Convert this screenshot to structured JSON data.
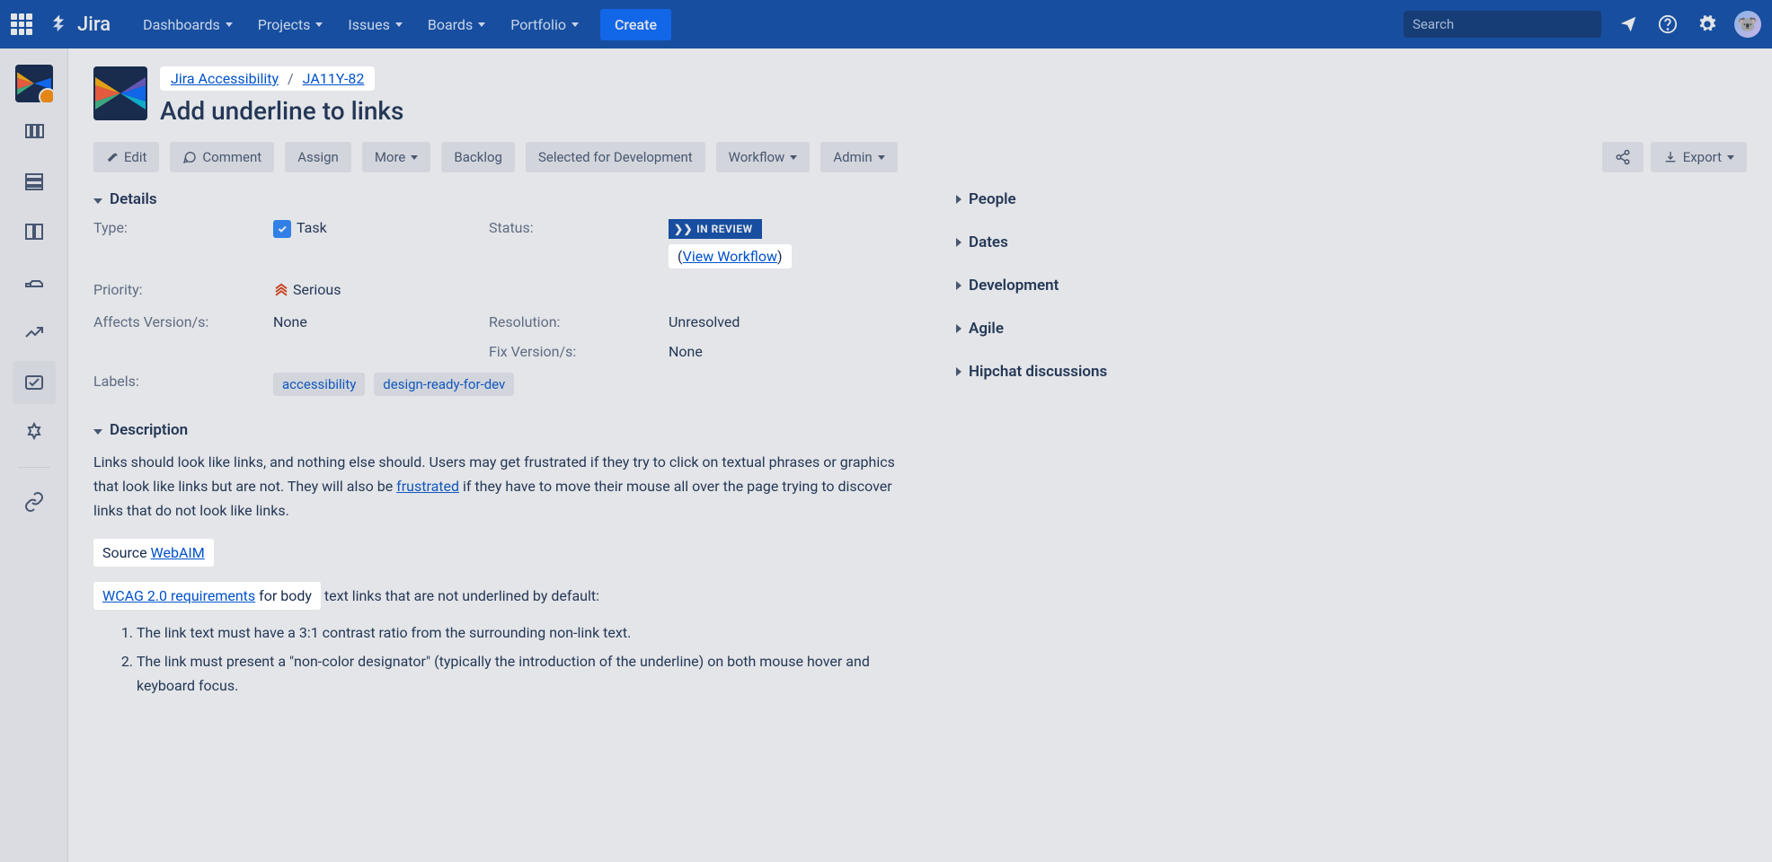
{
  "nav": {
    "logo": "Jira",
    "items": [
      "Dashboards",
      "Projects",
      "Issues",
      "Boards",
      "Portfolio"
    ],
    "create": "Create",
    "search_placeholder": "Search"
  },
  "breadcrumb": {
    "project": "Jira Accessibility",
    "issue_key": "JA11Y-82"
  },
  "issue": {
    "title": "Add underline to links"
  },
  "actions": {
    "edit": "Edit",
    "comment": "Comment",
    "assign": "Assign",
    "more": "More",
    "backlog": "Backlog",
    "selected": "Selected for Development",
    "workflow": "Workflow",
    "admin": "Admin",
    "export": "Export"
  },
  "details": {
    "header": "Details",
    "type_label": "Type:",
    "type_value": "Task",
    "priority_label": "Priority:",
    "priority_value": "Serious",
    "affects_label": "Affects Version/s:",
    "affects_value": "None",
    "labels_label": "Labels:",
    "labels": [
      "accessibility",
      "design-ready-for-dev"
    ],
    "status_label": "Status:",
    "status_value": "IN REVIEW",
    "view_workflow": "View Workflow",
    "resolution_label": "Resolution:",
    "resolution_value": "Unresolved",
    "fix_label": "Fix Version/s:",
    "fix_value": "None"
  },
  "description": {
    "header": "Description",
    "p1a": "Links should look like links, and nothing else should. Users may get frustrated if they try to click on textual phrases or graphics that look like links but are not. They will also be ",
    "p1_link": "frustrated",
    "p1b": " if they have to move their mouse all over the page trying to discover links that do not look like links.",
    "source_label": "Source ",
    "source_link": "WebAIM",
    "wcag_link": "WCAG 2.0 requirements",
    "wcag_rest": " for body text links that are not underlined by default:",
    "li1": "The link text must have a 3:1 contrast ratio from the surrounding non-link text.",
    "li2": "The link must present a \"non-color designator\" (typically the introduction of the underline) on both mouse hover and keyboard focus."
  },
  "side": {
    "people": "People",
    "dates": "Dates",
    "development": "Development",
    "agile": "Agile",
    "hipchat": "Hipchat discussions"
  }
}
